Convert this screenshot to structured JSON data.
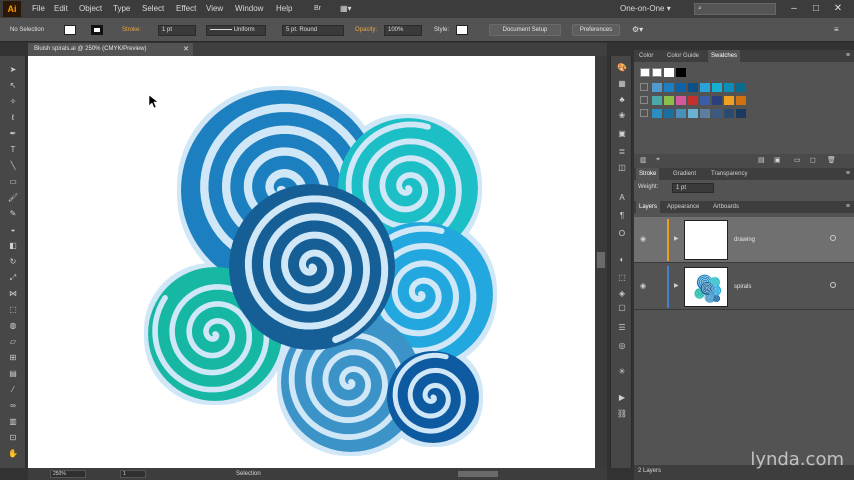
{
  "app": {
    "logo": "Ai",
    "menus": [
      "File",
      "Edit",
      "Object",
      "Type",
      "Select",
      "Effect",
      "View",
      "Window",
      "Help"
    ],
    "workspace": "One-on-One ▾",
    "window_buttons": [
      "–",
      "□",
      "✕"
    ]
  },
  "controlbar": {
    "selection_label": "No Selection",
    "stroke_label": "Stroke:",
    "stroke_weight": "1 pt",
    "stroke_profile": "Uniform",
    "brush": "5 pt. Round",
    "opacity_label": "Opacity:",
    "opacity_value": "100%",
    "style_label": "Style:",
    "document_setup": "Document Setup",
    "preferences": "Preferences"
  },
  "document": {
    "tab_title": "Bluish spirals.ai @ 250% (CMYK/Preview)",
    "tab_close": "✕"
  },
  "statusbar": {
    "zoom": "250%",
    "page": "1",
    "current_tool": "Selection"
  },
  "swatches_panel": {
    "tabs": [
      "Color",
      "Color Guide",
      "Swatches"
    ],
    "active_tab": "Swatches",
    "colors": {
      "row1": [
        "#4f9bd0",
        "#1e7fc4",
        "#0e63a8",
        "#0d4f87",
        "#2aa3d8",
        "#16b0d4",
        "#0b8fb8",
        "#0a6b8f"
      ],
      "row2": [
        "#4aa8a8",
        "#8bbf4a",
        "#d25a9a",
        "#c43030",
        "#3a5fa8",
        "#2b3f7a",
        "#f0a020",
        "#d07010"
      ],
      "row3": [
        "#2a8fc0",
        "#1a6fa0",
        "#4a90b8",
        "#6ab0d0",
        "#5a7fa0",
        "#3a5a80",
        "#2a4a70",
        "#1a3a60"
      ]
    }
  },
  "stroke_panel": {
    "tabs": [
      "Stroke",
      "Gradient",
      "Transparency"
    ],
    "active_tab": "Stroke",
    "weight_label": "Weight:",
    "weight_value": "1 pt"
  },
  "layers_panel": {
    "tabs": [
      "Layers",
      "Appearance",
      "Artboards"
    ],
    "active_tab": "Layers",
    "layers": [
      {
        "name": "drawing",
        "color": "#e8a020"
      },
      {
        "name": "spirals",
        "color": "#4a7fd0"
      }
    ],
    "count": "2 Layers"
  },
  "artwork_colors": {
    "blue_large": "#1b7fc0",
    "teal": "#1fbfc6",
    "navy": "#175e96",
    "sky": "#24a8df",
    "green": "#17b8a4",
    "mid_blue": "#3a93c8",
    "dark_small": "#0e5aa0",
    "halo": "#cfe7f6"
  },
  "watermark": "lynda.com"
}
